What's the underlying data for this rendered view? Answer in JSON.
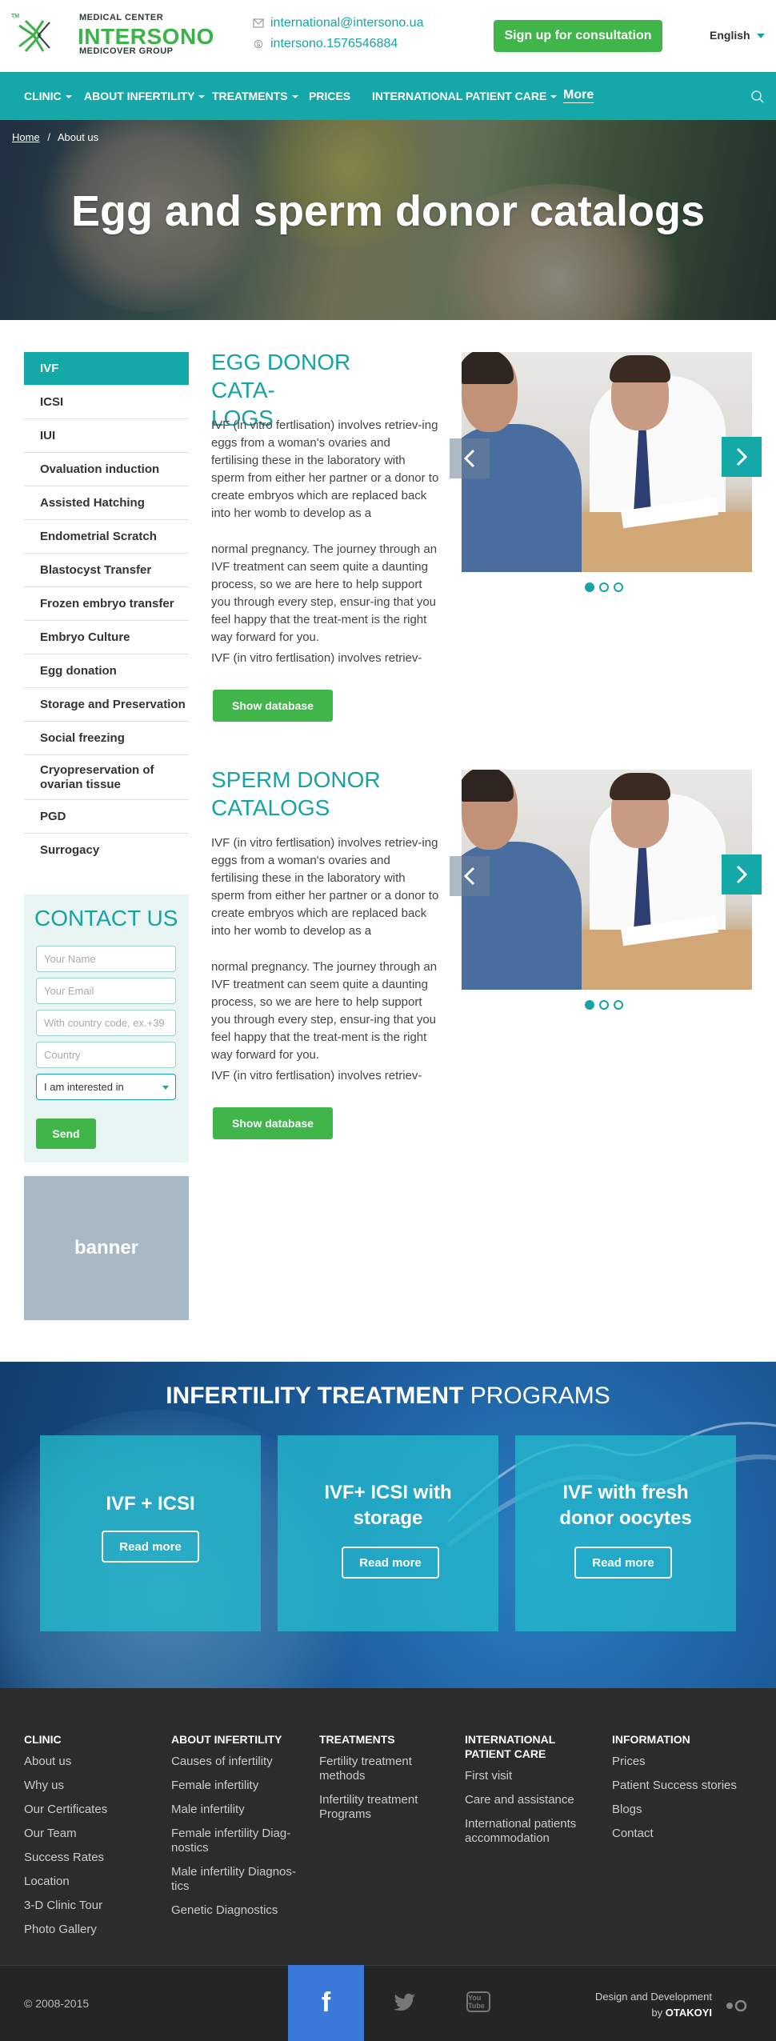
{
  "header": {
    "logo": {
      "top_text": "MEDICAL CENTER",
      "brand": "INTERSONO",
      "group": "MEDICOVER GROUP",
      "tm": "TM"
    },
    "email": "international@intersono.ua",
    "skype": "intersono.1576546884",
    "cta_label": "Sign up for consultation",
    "language": "English"
  },
  "nav": {
    "items": [
      "CLINIC",
      "ABOUT INFERTILITY",
      "TREATMENTS",
      "PRICES",
      "INTERNATIONAL PATIENT CARE"
    ],
    "more": "More"
  },
  "hero": {
    "breadcrumb_home": "Home",
    "breadcrumb_sep": "/",
    "breadcrumb_current": "About us",
    "title": "Egg and sperm donor catalogs"
  },
  "sidebar": {
    "items": [
      "IVF",
      "ICSI",
      "IUI",
      "Ovaluation induction",
      "Assisted Hatching",
      "Endometrial Scratch",
      "Blastocyst Transfer",
      "Frozen embryo transfer",
      "Embryo Culture",
      "Egg donation",
      "Storage and Preservation",
      "Social freezing",
      "Cryopreservation of ovarian tissue",
      "PGD",
      "Surrogacy"
    ]
  },
  "contact_form": {
    "title": "CONTACT US",
    "name_placeholder": "Your Name",
    "email_placeholder": "Your Email",
    "phone_placeholder": "With country code,  ex.+39",
    "country_placeholder": "Country",
    "interest_value": "I am interested in",
    "send_label": "Send"
  },
  "banner": {
    "label": "banner"
  },
  "sections": [
    {
      "title_line1": "EGG DONOR CATA-",
      "title_line2": "LOGS",
      "para1": "IVF (in vitro fertlisation) involves retriev-ing eggs from a woman's ovaries and fertilising these in the laboratory with sperm from either her partner or a donor to create embryos which are replaced back into her womb to develop as a",
      "para2": "normal pregnancy. The journey through an IVF treatment can seem quite a daunting process, so we are here to help support you through every step, ensur-ing that you feel happy that the treat-ment is the right way forward for you.",
      "para3": "IVF (in vitro fertlisation) involves retriev-",
      "button": "Show database"
    },
    {
      "title_line1": "SPERM DONOR",
      "title_line2": "CATALOGS",
      "para1": "IVF (in vitro fertlisation) involves retriev-ing eggs from a woman's ovaries and fertilising these in the laboratory with sperm from either her partner or a donor to create embryos which are replaced back into her womb to develop as a",
      "para2": "normal pregnancy. The journey through an IVF treatment can seem quite a daunting process, so we are here to help support you through every step, ensur-ing that you feel happy that the treat-ment is the right way forward for you.",
      "para3": "IVF (in vitro fertlisation) involves retriev-",
      "button": "Show database"
    }
  ],
  "slider": {
    "slide_count": 3,
    "active_slide": 1
  },
  "programs": {
    "title_bold": "INFERTILITY TREATMENT",
    "title_light": "PROGRAMS",
    "cards": [
      {
        "line1": "IVF + ICSI",
        "line2": "",
        "button": "Read more"
      },
      {
        "line1": "IVF+ ICSI with",
        "line2": "storage",
        "button": "Read more"
      },
      {
        "line1": "IVF with fresh",
        "line2": "donor oocytes",
        "button": "Read more"
      }
    ]
  },
  "footer": {
    "columns": [
      {
        "heading1": "CLINIC",
        "heading2": "",
        "links": [
          "About us",
          "Why us",
          "Our Certificates",
          "Our Team",
          "Success Rates",
          "Location",
          "3-D Clinic Tour",
          "Photo Gallery"
        ]
      },
      {
        "heading1": "ABOUT INFERTILITY",
        "heading2": "",
        "links": [
          "Causes of infertility",
          "Female infertility",
          "Male infertility",
          "Female infertility Diag-nostics",
          "Male infertility Diagnos-tics",
          "Genetic Diagnostics"
        ]
      },
      {
        "heading1": "TREATMENTS",
        "heading2": "",
        "links": [
          "Fertility treatment methods",
          "Infertility treatment Programs"
        ]
      },
      {
        "heading1": "INTERNATIONAL",
        "heading2": "PATIENT CARE",
        "links": [
          "First visit",
          "Care and assistance",
          "International patients accommodation"
        ]
      },
      {
        "heading1": "INFORMATION",
        "heading2": "",
        "links": [
          "Prices",
          "Patient Success stories",
          "Blogs",
          "Contact"
        ]
      }
    ],
    "copyright": "© 2008-2015",
    "facebook": "f",
    "youtube": "You Tube",
    "dev_line1": "Design and Development",
    "dev_by": "by",
    "dev_name": "OTAKOYI"
  },
  "colors": {
    "teal": "#14a8a8",
    "green": "#3fb54a",
    "footer": "#2c2c2c",
    "facebook": "#3b79d8"
  },
  "icons": [
    "email-icon",
    "skype-icon",
    "search-icon",
    "chevron-left-icon",
    "chevron-right-icon",
    "facebook-icon",
    "twitter-icon",
    "youtube-icon"
  ]
}
